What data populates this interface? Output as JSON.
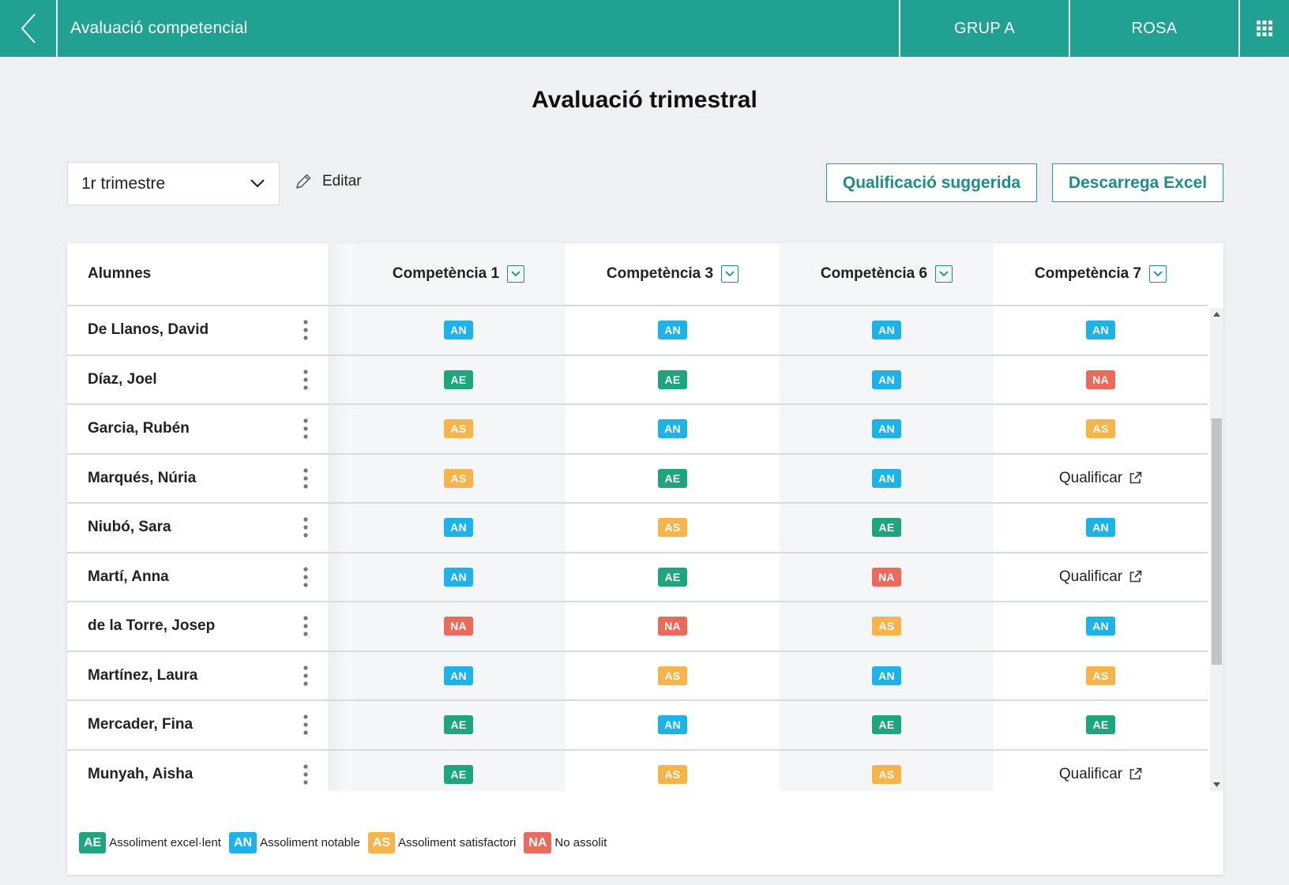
{
  "topbar": {
    "title": "Avaluació competencial",
    "group_label": "GRUP A",
    "user_label": "ROSA",
    "back_icon": "chevron-left-icon",
    "apps_icon": "grid-icon",
    "color": "#21a192"
  },
  "page": {
    "title": "Avaluació trimestral"
  },
  "toolbar": {
    "term_value": "1r trimestre",
    "edit_label": "Editar",
    "suggested_label": "Qualificació suggerida",
    "excel_label": "Descarrega Excel"
  },
  "table": {
    "students_header": "Alumnes",
    "competencies": [
      "Competència 1",
      "Competència 3",
      "Competència 6",
      "Competència 7"
    ],
    "qualify_label": "Qualificar",
    "rows": [
      {
        "name": "De Llanos, David",
        "grades": [
          "AN",
          "AN",
          "AN",
          "AN"
        ]
      },
      {
        "name": "Díaz, Joel",
        "grades": [
          "AE",
          "AE",
          "AN",
          "NA"
        ]
      },
      {
        "name": "Garcia, Rubén",
        "grades": [
          "AS",
          "AN",
          "AN",
          "AS"
        ]
      },
      {
        "name": "Marqués, Núria",
        "grades": [
          "AS",
          "AE",
          "AN",
          ""
        ]
      },
      {
        "name": "Niubó, Sara",
        "grades": [
          "AN",
          "AS",
          "AE",
          "AN"
        ]
      },
      {
        "name": "Martí, Anna",
        "grades": [
          "AN",
          "AE",
          "NA",
          ""
        ]
      },
      {
        "name": "de la Torre, Josep",
        "grades": [
          "NA",
          "NA",
          "AS",
          "AN"
        ]
      },
      {
        "name": "Martínez, Laura",
        "grades": [
          "AN",
          "AS",
          "AN",
          "AS"
        ]
      },
      {
        "name": "Mercader, Fina",
        "grades": [
          "AE",
          "AN",
          "AE",
          "AE"
        ]
      },
      {
        "name": "Munyah, Aisha",
        "grades": [
          "AE",
          "AS",
          "AS",
          ""
        ]
      }
    ]
  },
  "legend": [
    {
      "code": "AE",
      "label": "Assoliment excel·lent",
      "color": "#1ea57d"
    },
    {
      "code": "AN",
      "label": "Assoliment notable",
      "color": "#1eb3e8"
    },
    {
      "code": "AS",
      "label": "Assoliment satisfactori",
      "color": "#f6b44a"
    },
    {
      "code": "NA",
      "label": "No assolit",
      "color": "#eb6a5c"
    }
  ]
}
